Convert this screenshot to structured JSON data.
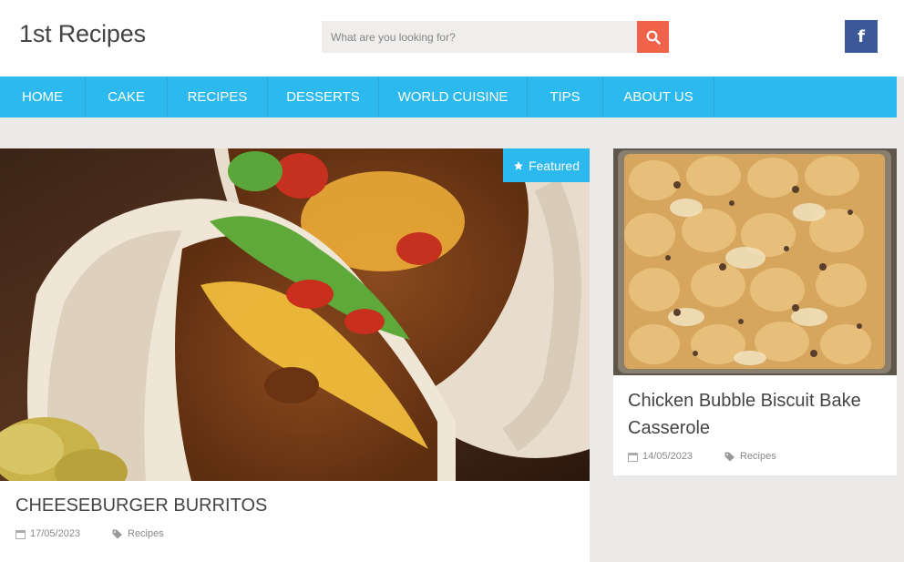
{
  "header": {
    "site_title": "1st Recipes",
    "search_placeholder": "What are you looking for?",
    "search_icon": "search-icon",
    "facebook_icon": "facebook-icon",
    "facebook_glyph": "f"
  },
  "nav": {
    "items": [
      "HOME",
      "CAKE",
      "RECIPES",
      "DESSERTS",
      "WORLD CUISINE",
      "TIPS",
      "ABOUT US"
    ]
  },
  "featured_post": {
    "badge": "Featured",
    "badge_icon": "star-icon",
    "title": "CHEESEBURGER BURRITOS",
    "date": "17/05/2023",
    "category": "Recipes"
  },
  "side_post": {
    "title": "Chicken Bubble Biscuit Bake Casserole",
    "date": "14/05/2023",
    "category": "Recipes"
  },
  "colors": {
    "accent": "#2bb9ee",
    "search_button": "#f0624a",
    "facebook": "#3b5998"
  }
}
